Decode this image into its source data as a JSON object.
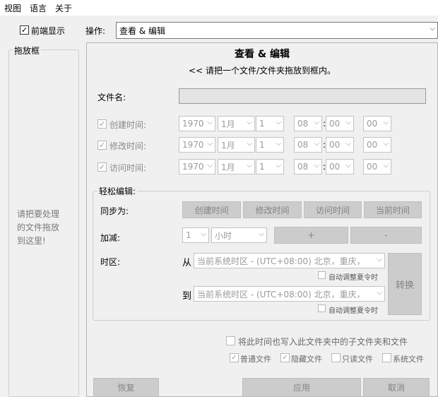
{
  "menu": {
    "view": "视图",
    "language": "语言",
    "about": "关于"
  },
  "top": {
    "front_check_label": "前端显示",
    "op_label": "操作:",
    "op_value": "查看 & 编辑"
  },
  "sidebar": {
    "title": "拖放框",
    "drop_hint_lines": [
      "请把要处理",
      "的文件拖放",
      "到这里!"
    ]
  },
  "main": {
    "title": "查看 & 编辑",
    "subtitle": "<< 请把一个文件/文件夹拖放到框内。",
    "filename_label": "文件名:",
    "filename_value": "",
    "times": [
      {
        "label": "创建时间:",
        "year": "1970",
        "month": "1月",
        "day": "1",
        "hour": "08",
        "minute": "00",
        "second": "00"
      },
      {
        "label": "修改时间:",
        "year": "1970",
        "month": "1月",
        "day": "1",
        "hour": "08",
        "minute": "00",
        "second": "00"
      },
      {
        "label": "访问时间:",
        "year": "1970",
        "month": "1月",
        "day": "1",
        "hour": "08",
        "minute": "00",
        "second": "00"
      }
    ],
    "time_sep": ":"
  },
  "easy": {
    "title": "轻松编辑:",
    "sync_label": "同步为:",
    "sync_buttons": [
      "创建时间",
      "修改时间",
      "访问时间",
      "当前时间"
    ],
    "adjust_label": "加减:",
    "adjust_amount": "1",
    "adjust_unit": "小时",
    "plus": "+",
    "minus": "-",
    "tz_label": "时区:",
    "from_label": "从",
    "to_label": "到",
    "tz_from": "当前系统时区 - (UTC+08:00) 北京，重庆，",
    "tz_to": "当前系统时区 - (UTC+08:00) 北京，重庆，",
    "dst_label": "自动调整夏令时",
    "convert": "转换"
  },
  "options": {
    "subfolders": "将此时间也写入此文件夹中的子文件夹和文件",
    "normal": "普通文件",
    "hidden": "隐藏文件",
    "readonly": "只读文件",
    "system": "系统文件"
  },
  "footer": {
    "restore": "恢复",
    "apply": "应用",
    "cancel": "取消"
  }
}
